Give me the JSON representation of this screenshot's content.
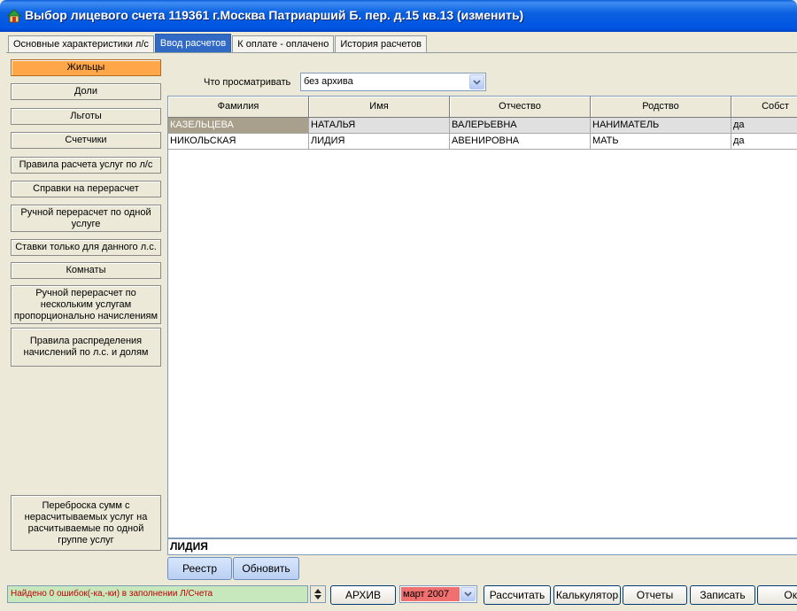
{
  "window": {
    "title": "Выбор лицевого счета  119361 г.Москва Патриарший Б. пер. д.15 кв.13 (изменить)",
    "icon": "home-icon"
  },
  "tabs": [
    {
      "label": "Основные характеристики л/с",
      "active": false
    },
    {
      "label": "Ввод расчетов",
      "active": true
    },
    {
      "label": "К оплате - оплачено",
      "active": false
    },
    {
      "label": "История расчетов",
      "active": false
    }
  ],
  "left_menu": [
    {
      "label": "Жильцы",
      "active": true
    },
    {
      "label": "Доли"
    },
    {
      "label": "Льготы"
    },
    {
      "label": "Счетчики"
    },
    {
      "label": "Правила расчета услуг по л/с"
    },
    {
      "label": "Справки на перерасчет"
    },
    {
      "label": "Ручной перерасчет по одной услуге"
    },
    {
      "label": "Ставки только для данного л.с."
    },
    {
      "label": "Комнаты"
    },
    {
      "label": "Ручной перерасчет по нескольким услугам пропорционально начислениям"
    },
    {
      "label": "Правила распределения начислений по л.с. и долям"
    },
    {
      "label": "Переброска сумм с нерасчитываемых услуг на расчитываемые по одной группе услуг"
    }
  ],
  "filter": {
    "label": "Что просматривать",
    "value": "без архива"
  },
  "grid": {
    "columns": [
      "Фамилия",
      "Имя",
      "Отчество",
      "Родство",
      "Собст"
    ],
    "rows": [
      [
        "КАЗЕЛЬЦЕВА",
        "НАТАЛЬЯ",
        "ВАЛЕРЬЕВНА",
        "НАНИМАТЕЛЬ",
        "да"
      ],
      [
        "НИКОЛЬСКАЯ",
        "ЛИДИЯ",
        "АВЕНИРОВНА",
        "МАТЬ",
        "да"
      ]
    ],
    "selected_row": 0
  },
  "current_name": "ЛИДИЯ",
  "grid_buttons": {
    "registry": "Реестр",
    "refresh": "Обновить"
  },
  "statusbar": {
    "message": "Найдено 0 ошибок(-ка,-ки) в заполнении Л/Счета",
    "archive": "АРХИВ",
    "month": "март 2007",
    "calculate": "Рассчитать",
    "calculator": "Калькулятор",
    "reports": "Отчеты",
    "save": "Записать",
    "ok": "Ок"
  },
  "colors": {
    "titlebar": "#0054e3",
    "active_tab": "#316ac5",
    "active_menu": "#ffa648",
    "status_bg": "#c7e8bd",
    "status_text": "#c00000",
    "month_bg": "#f07070"
  }
}
